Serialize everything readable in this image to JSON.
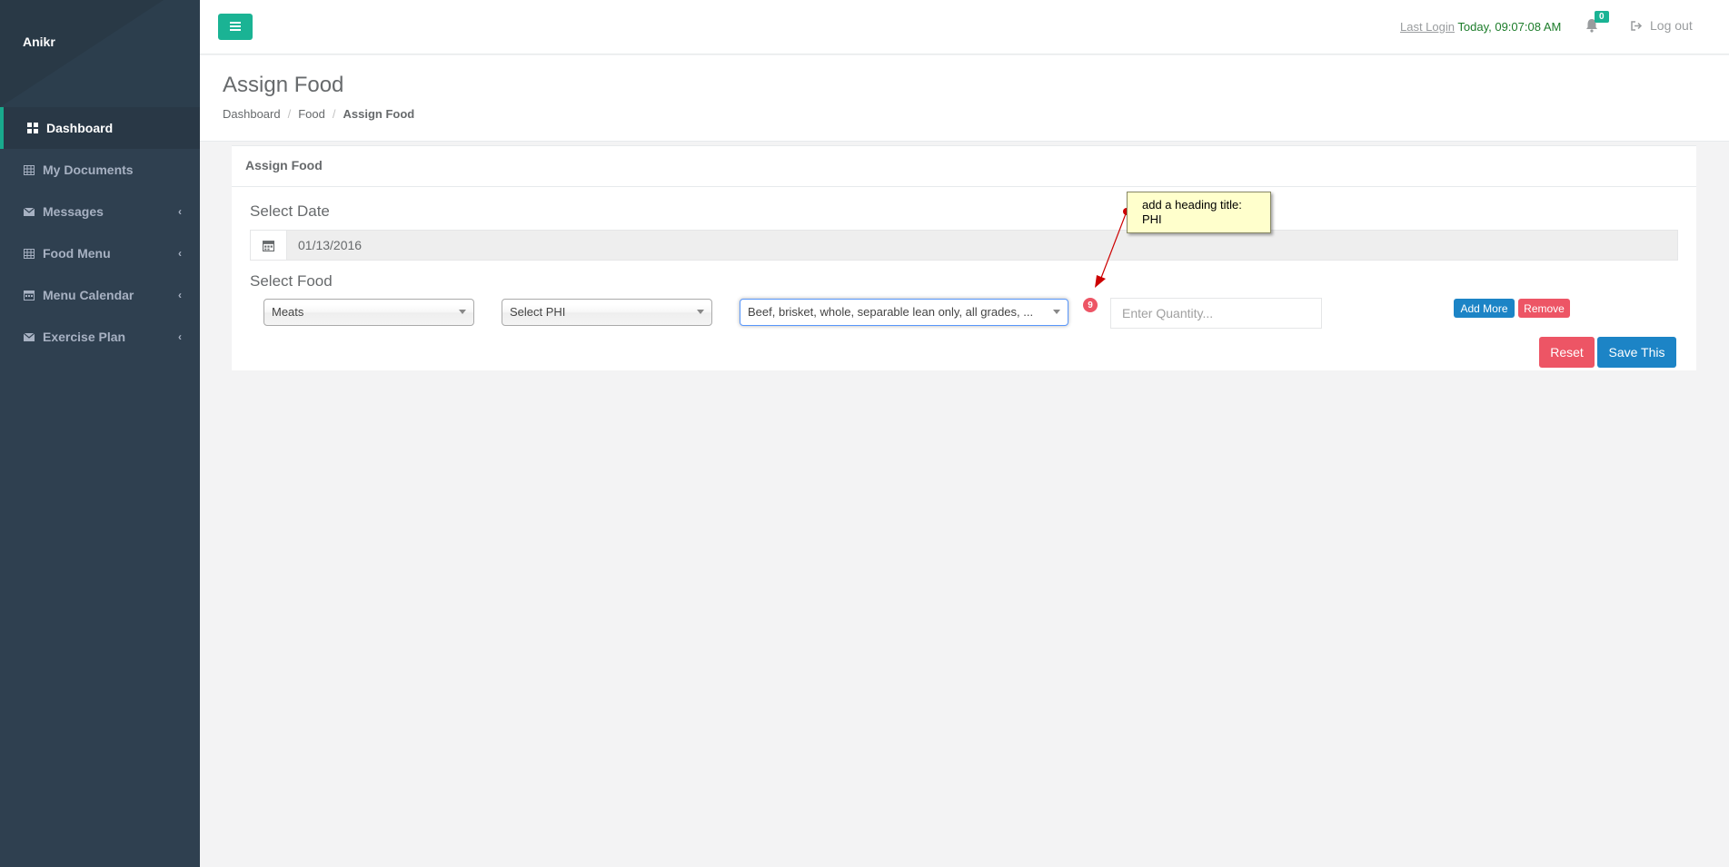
{
  "sidebar": {
    "brand": "Anikr",
    "items": [
      {
        "label": "Dashboard",
        "icon": "dashboard-icon"
      },
      {
        "label": "My Documents",
        "icon": "table-icon"
      },
      {
        "label": "Messages",
        "icon": "envelope-icon"
      },
      {
        "label": "Food Menu",
        "icon": "table-icon"
      },
      {
        "label": "Menu Calendar",
        "icon": "calendar-icon"
      },
      {
        "label": "Exercise Plan",
        "icon": "envelope-icon"
      }
    ]
  },
  "topbar": {
    "last_login_label": "Last Login",
    "last_login_time": "Today, 09:07:08 AM",
    "notification_count": "0",
    "logout_label": "Log out"
  },
  "page": {
    "title": "Assign Food",
    "breadcrumb": [
      "Dashboard",
      "Food",
      "Assign Food"
    ]
  },
  "panel": {
    "title": "Assign Food",
    "select_date_label": "Select Date",
    "date_value": "01/13/2016",
    "select_food_label": "Select Food",
    "category_select": "Meats",
    "phi_select": "Select PHI",
    "food_select": "Beef, brisket, whole, separable lean only, all grades, ...",
    "count_badge": "9",
    "quantity_placeholder": "Enter Quantity...",
    "add_more_label": "Add More",
    "remove_label": "Remove",
    "reset_label": "Reset",
    "save_label": "Save This"
  },
  "annotation": {
    "text": "add a heading title: PHI"
  },
  "colors": {
    "sidebar_bg": "#2f4050",
    "accent_green": "#1ab394",
    "primary_blue": "#1c84c6",
    "danger_red": "#ed5565"
  }
}
